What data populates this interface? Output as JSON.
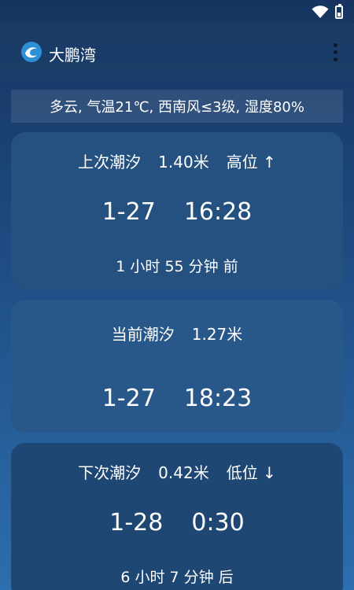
{
  "app": {
    "title": "大鹏湾"
  },
  "weather": {
    "summary": "多云, 气温21℃, 西南风≤3级, 湿度80%"
  },
  "tides": {
    "previous": {
      "label": "上次潮汐",
      "height": "1.40米",
      "type": "高位 ↑",
      "date": "1-27",
      "time": "16:28",
      "relative": "1 小时 55 分钟 前"
    },
    "current": {
      "label": "当前潮汐",
      "height": "1.27米",
      "date": "1-27",
      "time": "18:23"
    },
    "next": {
      "label": "下次潮汐",
      "height": "0.42米",
      "type": "低位 ↓",
      "date": "1-28",
      "time": "0:30",
      "relative": "6 小时 7 分钟 后"
    }
  },
  "icons": {
    "logo": "wave-logo-icon",
    "menu": "more-vertical-icon",
    "wifi": "wifi-icon",
    "battery": "battery-icon"
  },
  "colors": {
    "accent": "#2d8fd6",
    "card_prev": "#24517f",
    "card_current": "#28588a",
    "card_next": "#1f4773"
  }
}
